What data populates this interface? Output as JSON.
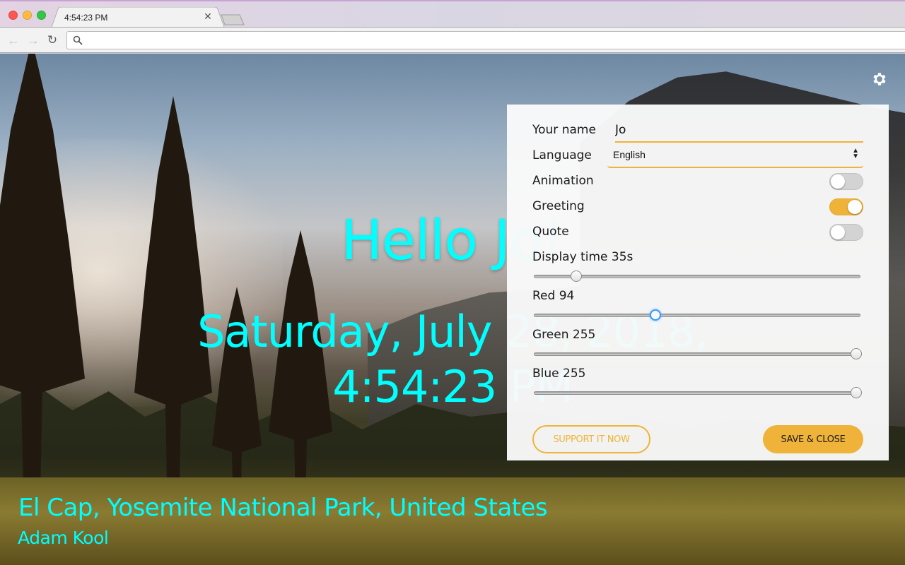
{
  "browser": {
    "tab_title": "4:54:23 PM",
    "address_value": "",
    "icons": {
      "back": "arrow-left",
      "forward": "arrow-right",
      "reload": "reload",
      "search": "magnifier",
      "close_tab": "close-x"
    }
  },
  "page": {
    "greeting": "Hello Jo!",
    "date": "Saturday, July 28, 2018,",
    "time": "4:54:23 PM",
    "location": "El Cap, Yosemite National Park, United States",
    "author": "Adam Kool",
    "text_color": "#00ffff",
    "settings_icon": "gear"
  },
  "settings": {
    "name_label": "Your name",
    "name_value": "Jo",
    "language_label": "Language",
    "language_value": "English",
    "toggles": [
      {
        "label": "Animation",
        "on": false
      },
      {
        "label": "Greeting",
        "on": true
      },
      {
        "label": "Quote",
        "on": false
      }
    ],
    "sliders": [
      {
        "label": "Display time 35s",
        "value": 35,
        "fraction": 0.12,
        "focused": false
      },
      {
        "label": "Red 94",
        "value": 94,
        "fraction": 0.3686,
        "focused": true
      },
      {
        "label": "Green 255",
        "value": 255,
        "fraction": 1.0,
        "focused": false
      },
      {
        "label": "Blue 255",
        "value": 255,
        "fraction": 1.0,
        "focused": false
      }
    ],
    "support_label": "SUPPORT IT NOW",
    "save_label": "SAVE & CLOSE",
    "accent_color": "#f0b33a"
  }
}
